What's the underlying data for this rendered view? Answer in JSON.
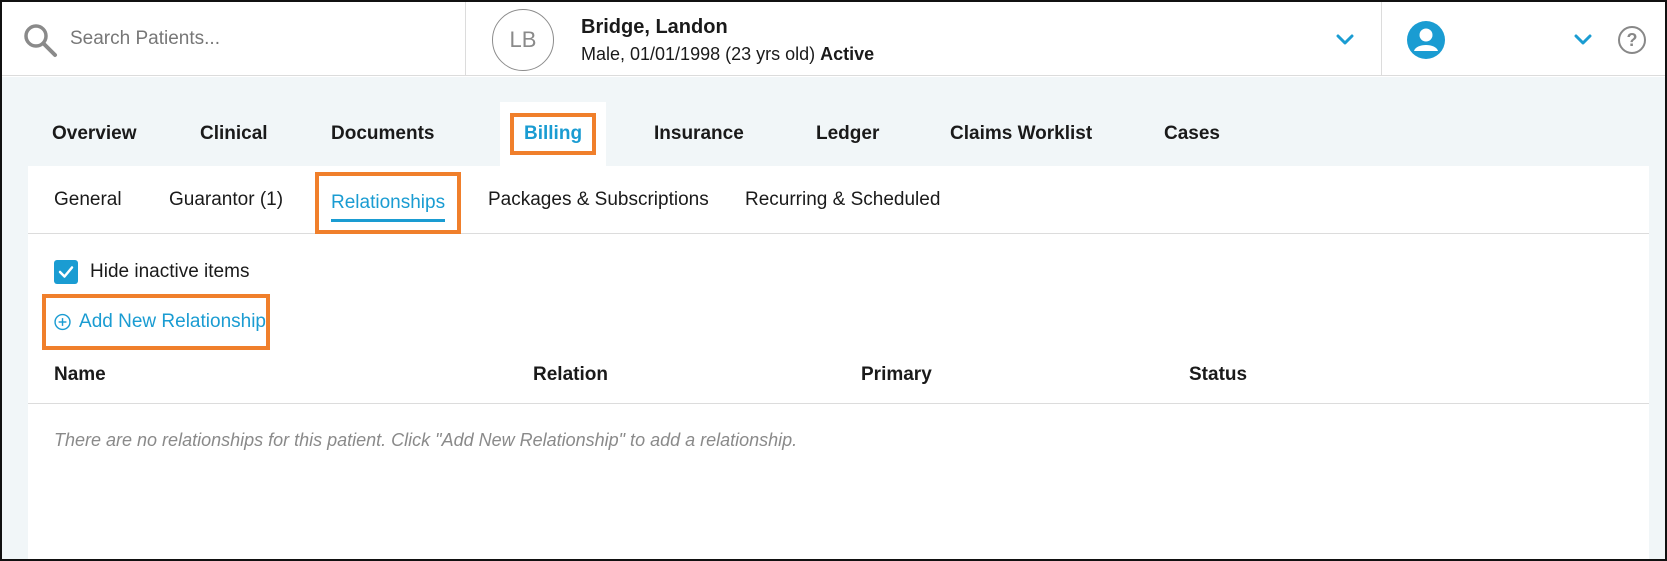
{
  "search": {
    "placeholder": "Search Patients..."
  },
  "patient": {
    "initials": "LB",
    "name": "Bridge, Landon",
    "info": "Male, 01/01/1998 (23 yrs old)",
    "status": "Active"
  },
  "main_tabs": [
    {
      "label": "Overview"
    },
    {
      "label": "Clinical"
    },
    {
      "label": "Documents"
    },
    {
      "label": "Billing",
      "active": true
    },
    {
      "label": "Insurance"
    },
    {
      "label": "Ledger"
    },
    {
      "label": "Claims Worklist"
    },
    {
      "label": "Cases"
    }
  ],
  "sub_tabs": [
    {
      "label": "General"
    },
    {
      "label": "Guarantor (1)"
    },
    {
      "label": "Relationships",
      "active": true
    },
    {
      "label": "Packages & Subscriptions"
    },
    {
      "label": "Recurring & Scheduled"
    }
  ],
  "hide_inactive": {
    "label": "Hide inactive items",
    "checked": true
  },
  "add_button": {
    "label": "Add New Relationship"
  },
  "table": {
    "columns": [
      "Name",
      "Relation",
      "Primary",
      "Status"
    ],
    "empty_message": "There are no relationships for this patient. Click \"Add New Relationship\" to add a relationship."
  },
  "colors": {
    "accent": "#1a9cd2",
    "highlight": "#f07f2b",
    "background": "#f1f6f8"
  },
  "icons": {
    "search": "search-icon",
    "user": "user-avatar-icon",
    "help": "help-icon",
    "chevron": "chevron-down-icon",
    "add": "plus-circle-icon",
    "check": "checkmark-icon"
  }
}
